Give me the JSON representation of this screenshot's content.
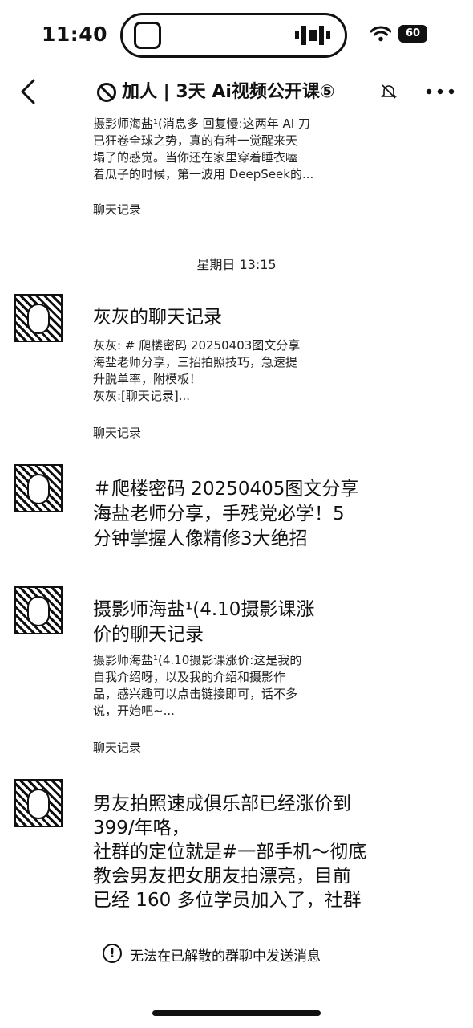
{
  "status_bar": {
    "time": "11:40",
    "battery": "60"
  },
  "nav": {
    "title": "加人 | 3天 Ai视频公开课⑤",
    "block_icon": "block-icon",
    "mute_icon": "bell-slash-icon"
  },
  "messages": [
    {
      "body_lines": [
        "摄影师海盐¹(消息多 回复慢:这两年 AI 刀",
        "已狂卷全球之势，真的有种一觉醒来天",
        "塌了的感觉。当你还在家里穿着睡衣嗑",
        "着瓜子的时候，第一波用 DeepSeek的..."
      ],
      "label": "聊天记录"
    },
    {
      "date": "星期日 13:15"
    },
    {
      "title": "灰灰的聊天记录",
      "body_lines": [
        "灰灰: # 爬楼密码 20250403图文分享",
        "海盐老师分享，三招拍照技巧，急速提",
        "升脱单率，附模板！",
        "灰灰:[聊天记录]..."
      ],
      "label": "聊天记录"
    },
    {
      "title_lines": [
        "＃爬楼密码 20250405图文分享",
        "海盐老师分享，手残党必学！5",
        "分钟掌握人像精修3大绝招"
      ]
    },
    {
      "title_lines": [
        "摄影师海盐¹(4.10摄影课涨",
        "价的聊天记录"
      ],
      "body_lines": [
        "摄影师海盐¹(4.10摄影课涨价:这是我的",
        "自我介绍呀，以及我的介绍和摄影作",
        "品，感兴趣可以点击链接即可，话不多",
        "说，开始吧~..."
      ],
      "label": "聊天记录"
    },
    {
      "title_lines": [
        "男友拍照速成俱乐部已经涨价到",
        "399/年咯，",
        "社群的定位就是#一部手机～彻底",
        "教会男友把女朋友拍漂亮，目前",
        "已经 160 多位学员加入了，社群"
      ]
    }
  ],
  "notice": {
    "text": "无法在已解散的群聊中发送消息",
    "icon": "exclamation-circle-icon"
  }
}
